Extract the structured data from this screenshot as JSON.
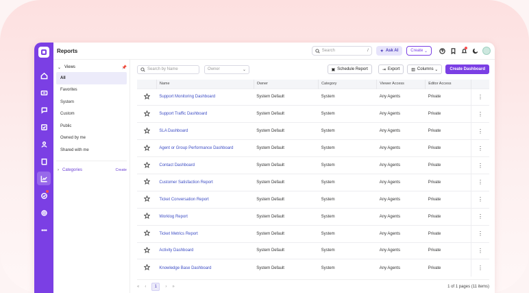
{
  "header": {
    "title": "Reports"
  },
  "topbar": {
    "search_placeholder": "Search",
    "search_shortcut": "/",
    "ask_ai_label": "Ask AI",
    "create_label": "Create"
  },
  "views": {
    "title": "Views",
    "items": [
      {
        "label": "All",
        "active": true
      },
      {
        "label": "Favorites"
      },
      {
        "label": "System"
      },
      {
        "label": "Custom"
      },
      {
        "label": "Public"
      },
      {
        "label": "Owned by me"
      },
      {
        "label": "Shared with me"
      }
    ],
    "categories_label": "Categories",
    "categories_create": "Create"
  },
  "toolbar": {
    "search_placeholder": "Search by Name",
    "owner_placeholder": "Owner",
    "schedule_label": "Schedule Report",
    "export_label": "Export",
    "columns_label": "Columns",
    "create_dashboard_label": "Create Dashboard"
  },
  "table": {
    "columns": [
      "Name",
      "Owner",
      "Category",
      "Viewer Access",
      "Editor Access"
    ],
    "rows": [
      [
        "Support Monitoring Dashboard",
        "System Default",
        "System",
        "Any Agents",
        "Private"
      ],
      [
        "Support Traffic Dashboard",
        "System Default",
        "System",
        "Any Agents",
        "Private"
      ],
      [
        "SLA Dashboard",
        "System Default",
        "System",
        "Any Agents",
        "Private"
      ],
      [
        "Agent or Group Performance Dashboard",
        "System Default",
        "System",
        "Any Agents",
        "Private"
      ],
      [
        "Contact Dashboard",
        "System Default",
        "System",
        "Any Agents",
        "Private"
      ],
      [
        "Customer Satisfaction Report",
        "System Default",
        "System",
        "Any Agents",
        "Private"
      ],
      [
        "Ticket Conversation Report",
        "System Default",
        "System",
        "Any Agents",
        "Private"
      ],
      [
        "Worklog Report",
        "System Default",
        "System",
        "Any Agents",
        "Private"
      ],
      [
        "Ticket Metrics Report",
        "System Default",
        "System",
        "Any Agents",
        "Private"
      ],
      [
        "Activity Dashboard",
        "System Default",
        "System",
        "Any Agents",
        "Private"
      ],
      [
        "Knowledge Base Dashboard",
        "System Default",
        "System",
        "Any Agents",
        "Private"
      ]
    ]
  },
  "pager": {
    "current": "1",
    "info": "1 of 1 pages (11 items)"
  },
  "colors": {
    "accent": "#7b3fe4",
    "link": "#3c4cc4"
  }
}
